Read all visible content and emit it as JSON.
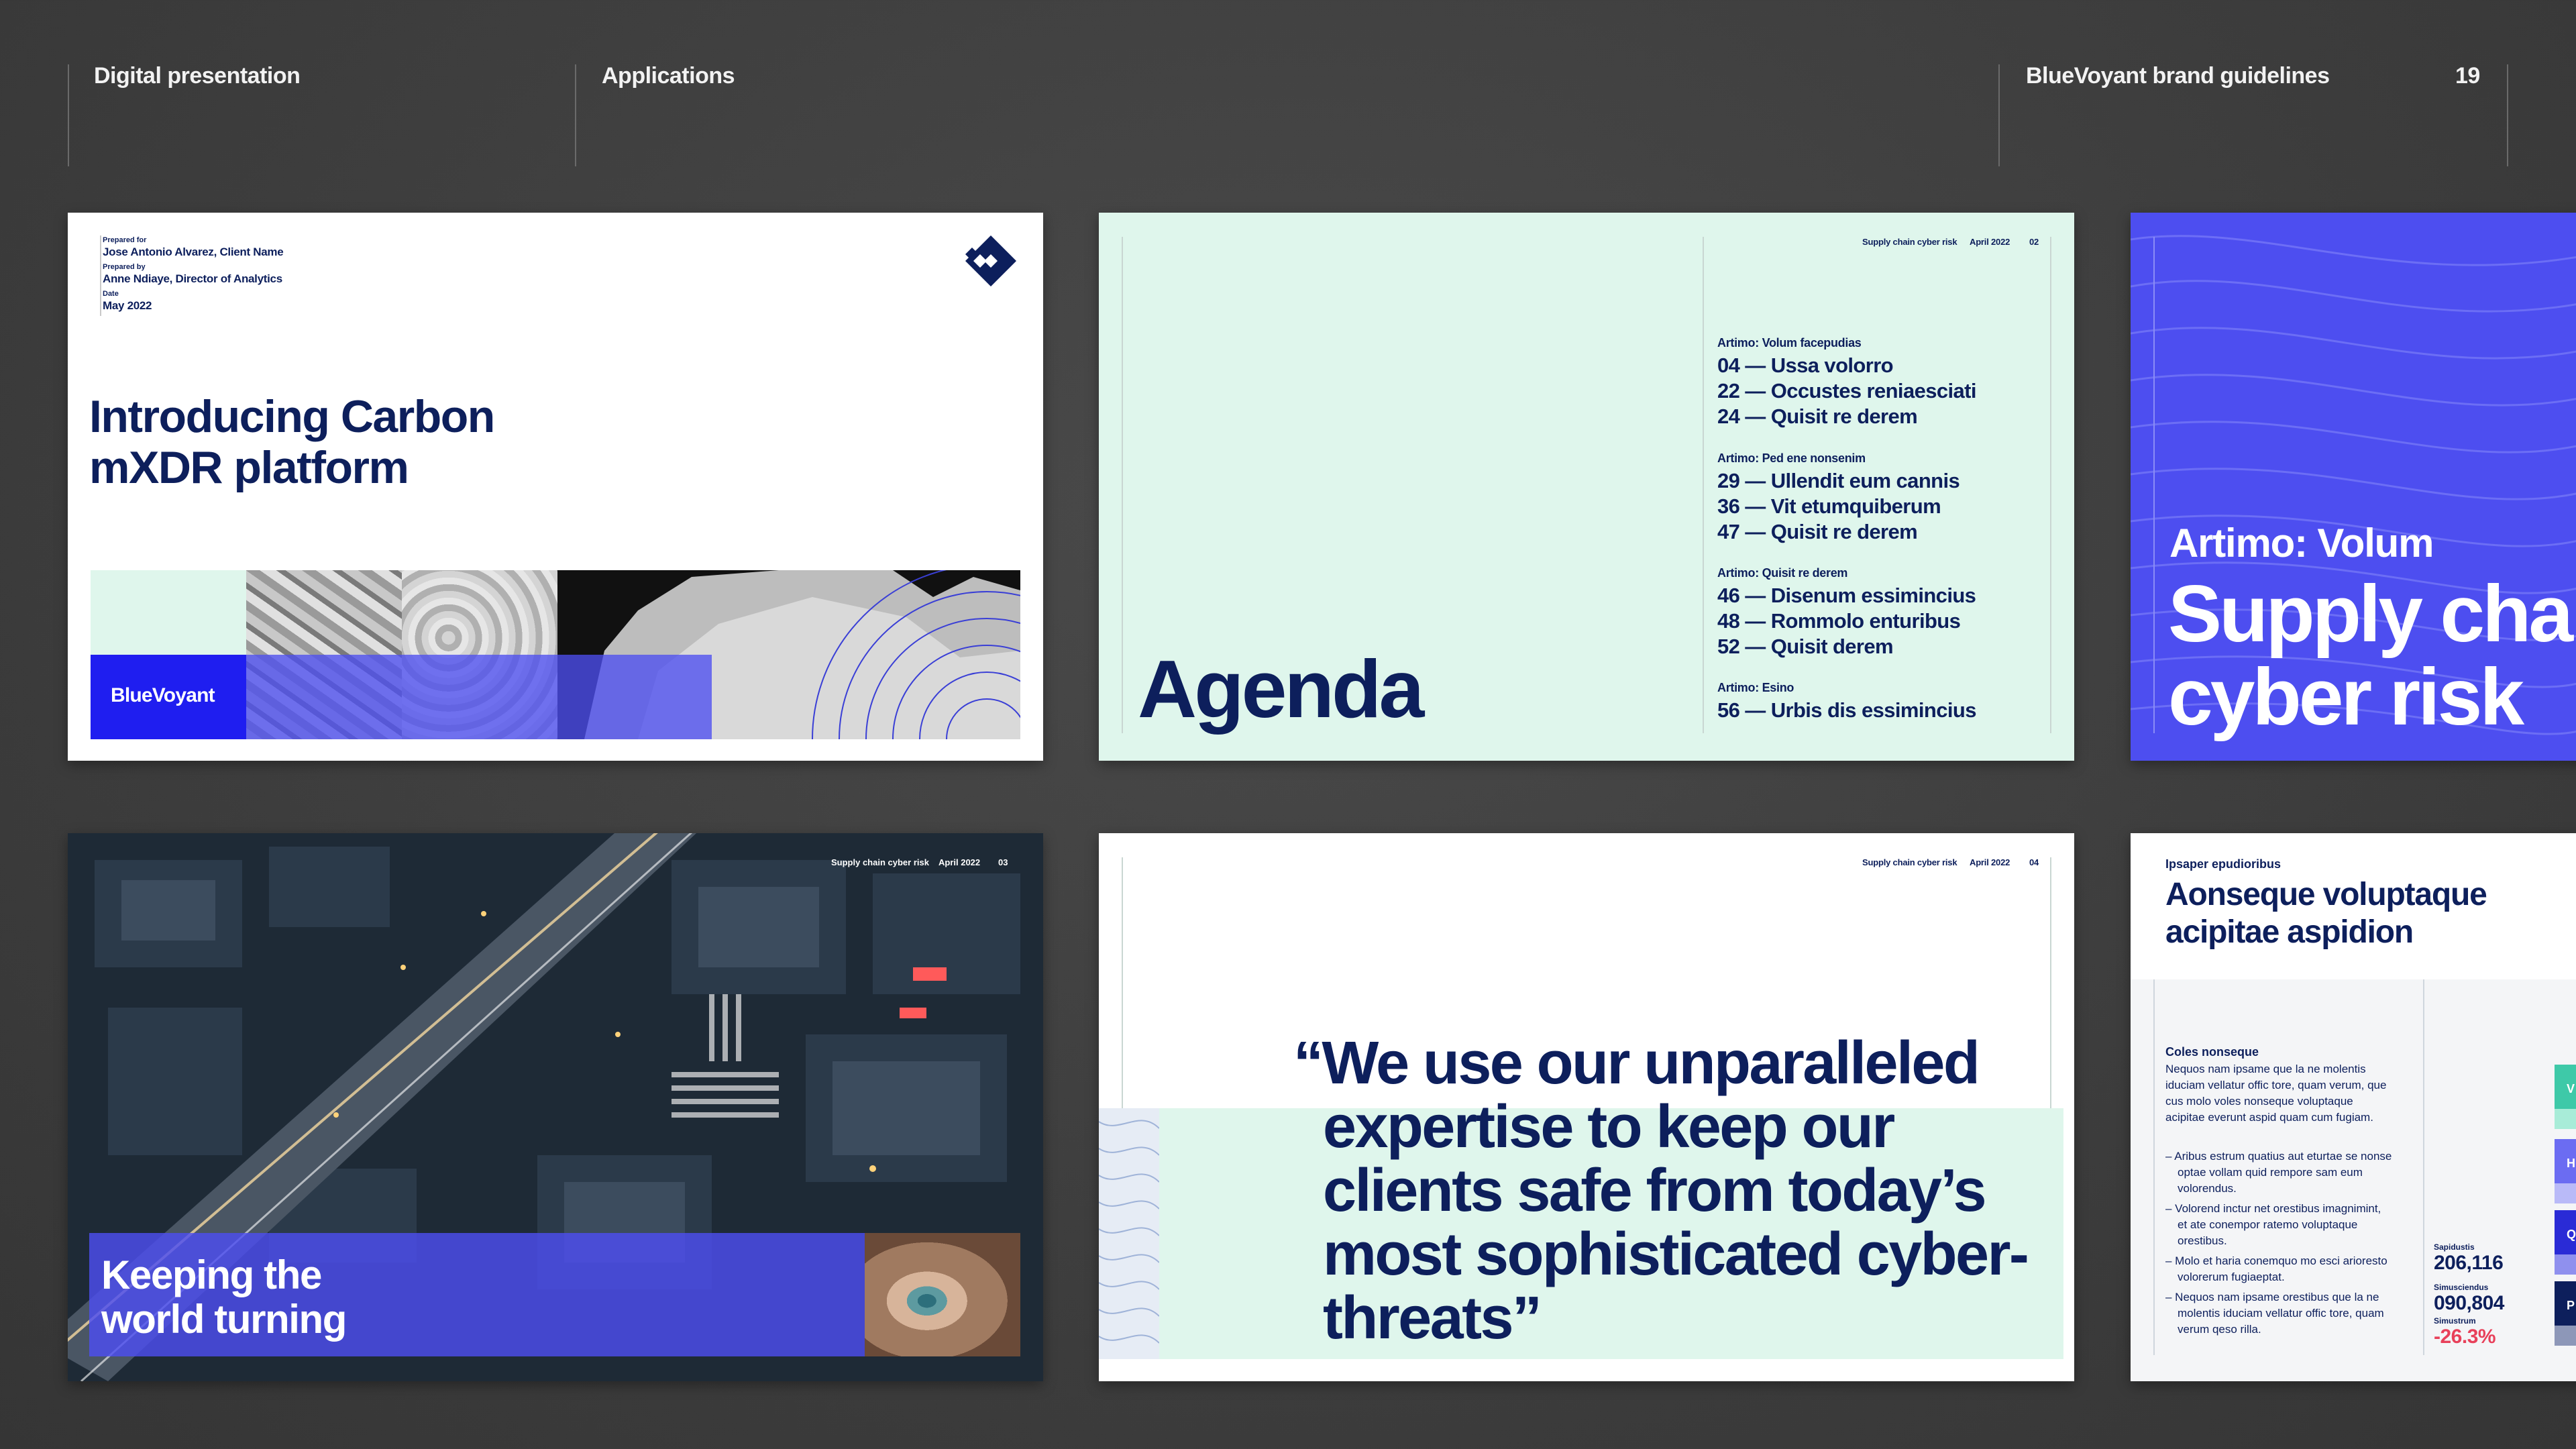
{
  "header": {
    "section": "Digital presentation",
    "chapter": "Applications",
    "guide": "BlueVoyant brand guidelines",
    "page": "19"
  },
  "slide1": {
    "meta": [
      {
        "key": "Prepared for",
        "value": "Jose Antonio Alvarez, Client Name"
      },
      {
        "key": "Prepared by",
        "value": "Anne Ndiaye, Director of Analytics"
      },
      {
        "key": "Date",
        "value": "May 2022"
      }
    ],
    "title": "Introducing Carbon mXDR platform",
    "logo_text": "BlueVoyant"
  },
  "slide2": {
    "running_title": "Supply chain cyber risk",
    "date": "April 2022",
    "page": "02",
    "title": "Agenda",
    "groups": [
      {
        "heading": "Artimo: Volum facepudias",
        "items": [
          "04 — Ussa volorro",
          "22 — Occustes reniaesciati",
          "24 — Quisit re derem"
        ]
      },
      {
        "heading": "Artimo: Ped ene nonsenim",
        "items": [
          "29 — Ullendit eum cannis",
          "36 — Vit etumquiberum",
          "47 — Quisit re derem"
        ]
      },
      {
        "heading": "Artimo: Quisit re derem",
        "items": [
          "46 — Disenum essimincius",
          "48 — Rommolo enturibus",
          "52 — Quisit derem"
        ]
      },
      {
        "heading": "Artimo: Esino",
        "items": [
          "56 — Urbis dis essimincius"
        ]
      }
    ]
  },
  "slide3": {
    "kicker": "Artimo: Volum",
    "line1": "Supply cha",
    "line2": "cyber risk"
  },
  "slide4": {
    "running_title": "Supply chain cyber risk",
    "date": "April 2022",
    "page": "03",
    "headline_line1": "Keeping the",
    "headline_line2": "world turning"
  },
  "slide5": {
    "running_title": "Supply chain cyber risk",
    "date": "April 2022",
    "page": "04",
    "quote": "“We use our unparalleled expertise to keep our clients safe from today’s most sophisticated cyber-threats”"
  },
  "slide6": {
    "eyebrow": "Ipsaper epudioribus",
    "title": "Aonseque voluptaque acipitae aspidion",
    "subhead": "Coles nonseque",
    "paragraph": "Nequos nam ipsame que la ne molentis iduciam vellatur offic tore, quam verum, que cus molo voles nonseque voluptaque acipitae everunt aspid quam cum fugiam.",
    "bullets": [
      "– Aribus estrum quatius aut eturtae se nonse optae vollam quid rempore sam eum volorendus.",
      "– Volorend inctur net orestibus imagnimint, et ate conempor ratemo voluptaque orestibus.",
      "– Molo et haria conemquo mo esci arioresto volorerum fugiaeptat.",
      "– Nequos nam ipsame orestibus que la ne molentis iduciam vellatur offic tore, quam verum qeso rilla."
    ],
    "stats": [
      {
        "label": "Sapidustis",
        "value": "206,116",
        "color": "#0d1f5c"
      },
      {
        "label": "Simusciendus",
        "value": "090,804",
        "color": "#0d1f5c"
      },
      {
        "label": "Simustrum",
        "value": "-26.3%",
        "color": "#e8405a"
      }
    ],
    "chips": [
      "V",
      "H",
      "Q",
      "P"
    ]
  }
}
